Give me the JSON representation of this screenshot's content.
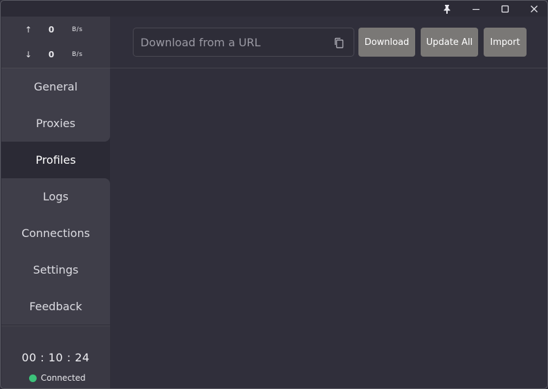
{
  "titlebar": {
    "pin_icon": "pin-icon",
    "minimize_icon": "minimize-icon",
    "maximize_icon": "maximize-icon",
    "close_icon": "close-icon"
  },
  "traffic": {
    "upload": {
      "arrow": "↑",
      "value": "0",
      "unit": "B/s"
    },
    "download": {
      "arrow": "↓",
      "value": "0",
      "unit": "B/s"
    }
  },
  "nav": {
    "items": [
      {
        "label": "General"
      },
      {
        "label": "Proxies"
      },
      {
        "label": "Profiles",
        "active": true
      },
      {
        "label": "Logs"
      },
      {
        "label": "Connections"
      },
      {
        "label": "Settings"
      },
      {
        "label": "Feedback"
      }
    ]
  },
  "status": {
    "uptime": "00 : 10 : 24",
    "connection": "Connected",
    "connection_color": "#3cc27a"
  },
  "toolbar": {
    "url_placeholder": "Download from a URL",
    "url_value": "",
    "paste_icon": "copy-icon",
    "download_label": "Download",
    "update_all_label": "Update All",
    "import_label": "Import"
  },
  "colors": {
    "accent_button": "#7a7876",
    "sidebar_active": "#2b2a35",
    "background": "#302f3b"
  }
}
